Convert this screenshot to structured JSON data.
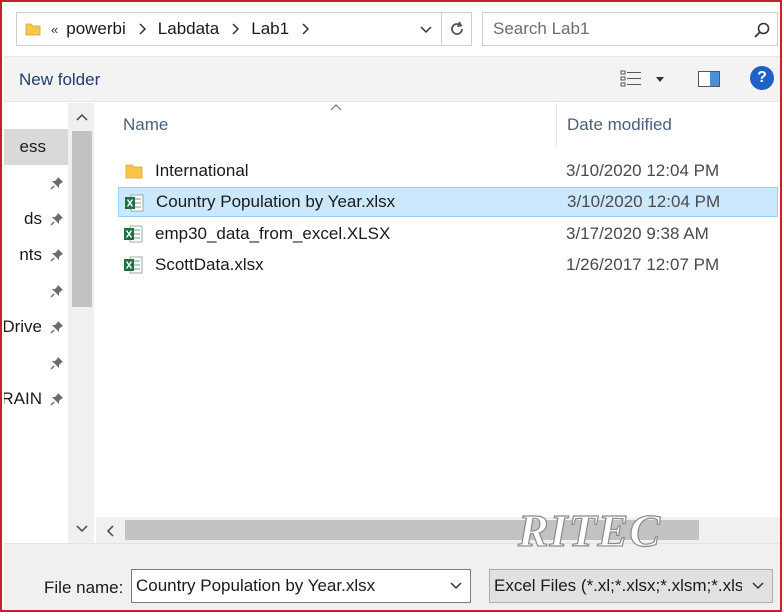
{
  "address_bar": {
    "overflow_glyph": "«",
    "crumbs": [
      "powerbi",
      "Labdata",
      "Lab1"
    ]
  },
  "search": {
    "placeholder": "Search Lab1"
  },
  "toolbar": {
    "new_folder_label": "New folder",
    "help_label": "?"
  },
  "nav": {
    "items": [
      {
        "label": "ess",
        "selected": true,
        "pinned": false
      },
      {
        "label": "",
        "pinned": true
      },
      {
        "label": "ds",
        "pinned": true
      },
      {
        "label": "nts",
        "pinned": true
      },
      {
        "label": "",
        "pinned": true
      },
      {
        "label": "Drive",
        "pinned": true
      },
      {
        "label": "",
        "pinned": true
      },
      {
        "label": "TRAIN",
        "pinned": true
      }
    ]
  },
  "columns": {
    "name": "Name",
    "date_modified": "Date modified"
  },
  "files": [
    {
      "name": "International",
      "date": "3/10/2020 12:04 PM",
      "type": "folder",
      "selected": false
    },
    {
      "name": "Country Population by Year.xlsx",
      "date": "3/10/2020 12:04 PM",
      "type": "excel",
      "selected": true
    },
    {
      "name": "emp30_data_from_excel.XLSX",
      "date": "3/17/2020 9:38 AM",
      "type": "excel",
      "selected": false
    },
    {
      "name": "ScottData.xlsx",
      "date": "1/26/2017 12:07 PM",
      "type": "excel",
      "selected": false
    }
  ],
  "bottom": {
    "file_name_label": "File name:",
    "file_name_value": "Country Population by Year.xlsx",
    "filter_value": "Excel Files (*.xl;*.xlsx;*.xlsm;*.xlsb"
  },
  "watermark": {
    "text": "RITEC"
  },
  "colors": {
    "frame_border": "#c8202a",
    "selection_bg": "#cce8ff",
    "selection_border": "#99d1ff",
    "excel_green": "#1e7145",
    "folder_yellow": "#f8c74a",
    "help_blue": "#1e62c7"
  }
}
